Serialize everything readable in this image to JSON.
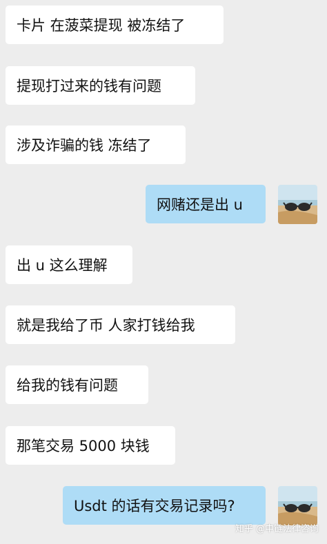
{
  "messages": [
    {
      "side": "left",
      "text": "卡片 在菠菜提现  被冻结了"
    },
    {
      "side": "left",
      "text": "提现打过来的钱有问题"
    },
    {
      "side": "left",
      "text": "涉及诈骗的钱 冻结了"
    },
    {
      "side": "right",
      "text": "网赌还是出 u"
    },
    {
      "side": "left",
      "text": "出 u  这么理解"
    },
    {
      "side": "left",
      "text": "就是我给了币  人家打钱给我"
    },
    {
      "side": "left",
      "text": " 给我的钱有问题"
    },
    {
      "side": "left",
      "text": "那笔交易 5000 块钱"
    },
    {
      "side": "right",
      "text": "Usdt 的话有交易记录吗?"
    }
  ],
  "watermark": "知乎 @中链法律咨询",
  "colors": {
    "background": "#ededed",
    "left_bubble": "#ffffff",
    "right_bubble": "#aedcf6"
  }
}
